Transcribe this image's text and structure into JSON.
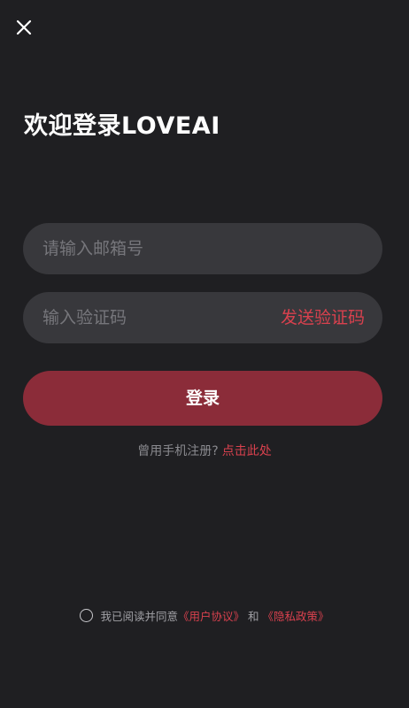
{
  "header": {
    "close_icon": "close-icon"
  },
  "page": {
    "title": "欢迎登录LOVEAI"
  },
  "form": {
    "email_placeholder": "请输入邮箱号",
    "email_value": "",
    "code_placeholder": "输入验证码",
    "code_value": "",
    "send_code_label": "发送验证码",
    "login_label": "登录"
  },
  "register": {
    "prompt": "曾用手机注册?",
    "link_label": "点击此处"
  },
  "agreement": {
    "prefix": "我已阅读并同意",
    "user_agreement": "《用户协议》",
    "and_text": "和",
    "privacy_policy": "《隐私政策》",
    "checked": false
  },
  "colors": {
    "background": "#1f1f22",
    "input_bg": "#38383c",
    "accent": "#d9414e",
    "button_bg": "#8b2c39",
    "placeholder": "#76767b"
  }
}
